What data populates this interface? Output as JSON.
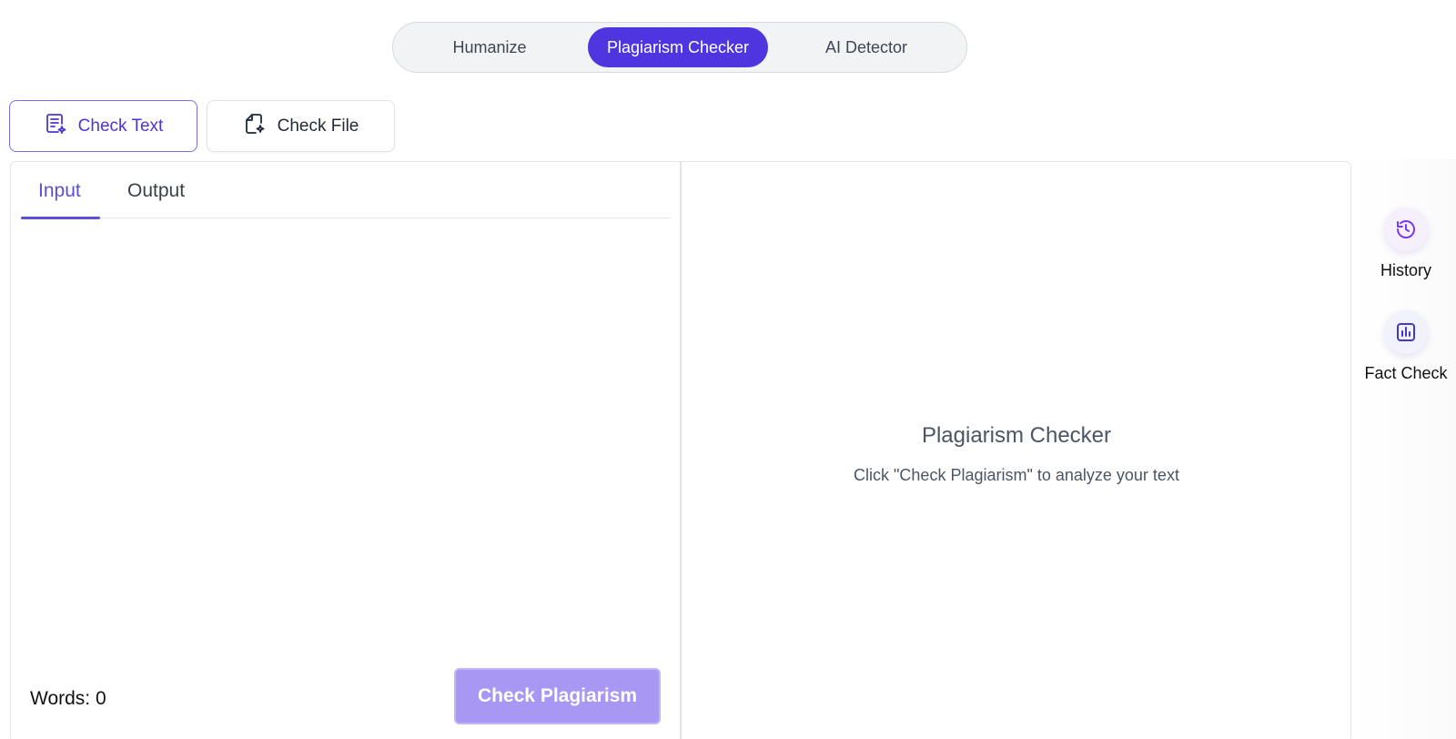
{
  "mode_tabs": {
    "humanize": "Humanize",
    "plagiarism_checker": "Plagiarism Checker",
    "ai_detector": "AI Detector",
    "active": "Plagiarism Checker"
  },
  "source_buttons": {
    "check_text": "Check Text",
    "check_file": "Check File",
    "active": "Check Text"
  },
  "editor": {
    "tabs": {
      "input": "Input",
      "output": "Output",
      "active": "Input"
    },
    "input_value": "",
    "word_count_label": "Words: 0",
    "submit_label": "Check Plagiarism"
  },
  "result_panel": {
    "title": "Plagiarism Checker",
    "subtitle": "Click \"Check Plagiarism\" to analyze your text"
  },
  "side_rail": {
    "history": {
      "label": "History",
      "icon": "history-icon"
    },
    "fact_check": {
      "label": "Fact Check",
      "icon": "bar-chart-icon"
    }
  },
  "colors": {
    "accent": "#4f35e0",
    "accent_disabled": "#a897f3",
    "tab_active": "#5b4fd6"
  }
}
